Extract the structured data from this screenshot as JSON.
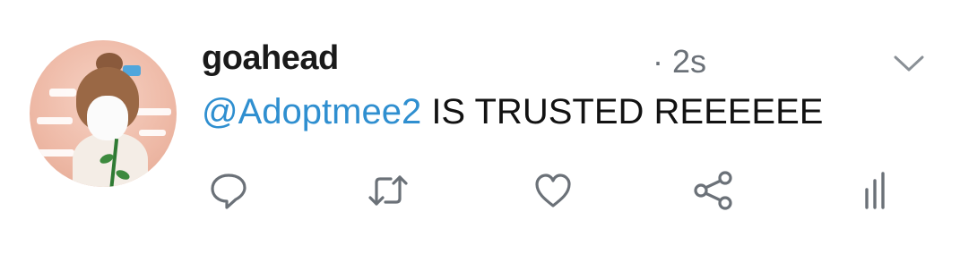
{
  "tweet": {
    "user": {
      "display_name": "goahead"
    },
    "timestamp": "· 2s",
    "text": {
      "mention": "@Adoptmee2",
      "body": " IS TRUSTED REEEEEE"
    },
    "actions": [
      {
        "name": "reply",
        "icon": "reply-icon"
      },
      {
        "name": "retweet",
        "icon": "retweet-icon"
      },
      {
        "name": "like",
        "icon": "heart-icon"
      },
      {
        "name": "share",
        "icon": "share-icon"
      },
      {
        "name": "analytics",
        "icon": "analytics-icon"
      }
    ]
  },
  "colors": {
    "mention": "#2f8fd0",
    "name": "#1a1a1a",
    "muted": "#6b7178",
    "icon": "#6b7178"
  }
}
